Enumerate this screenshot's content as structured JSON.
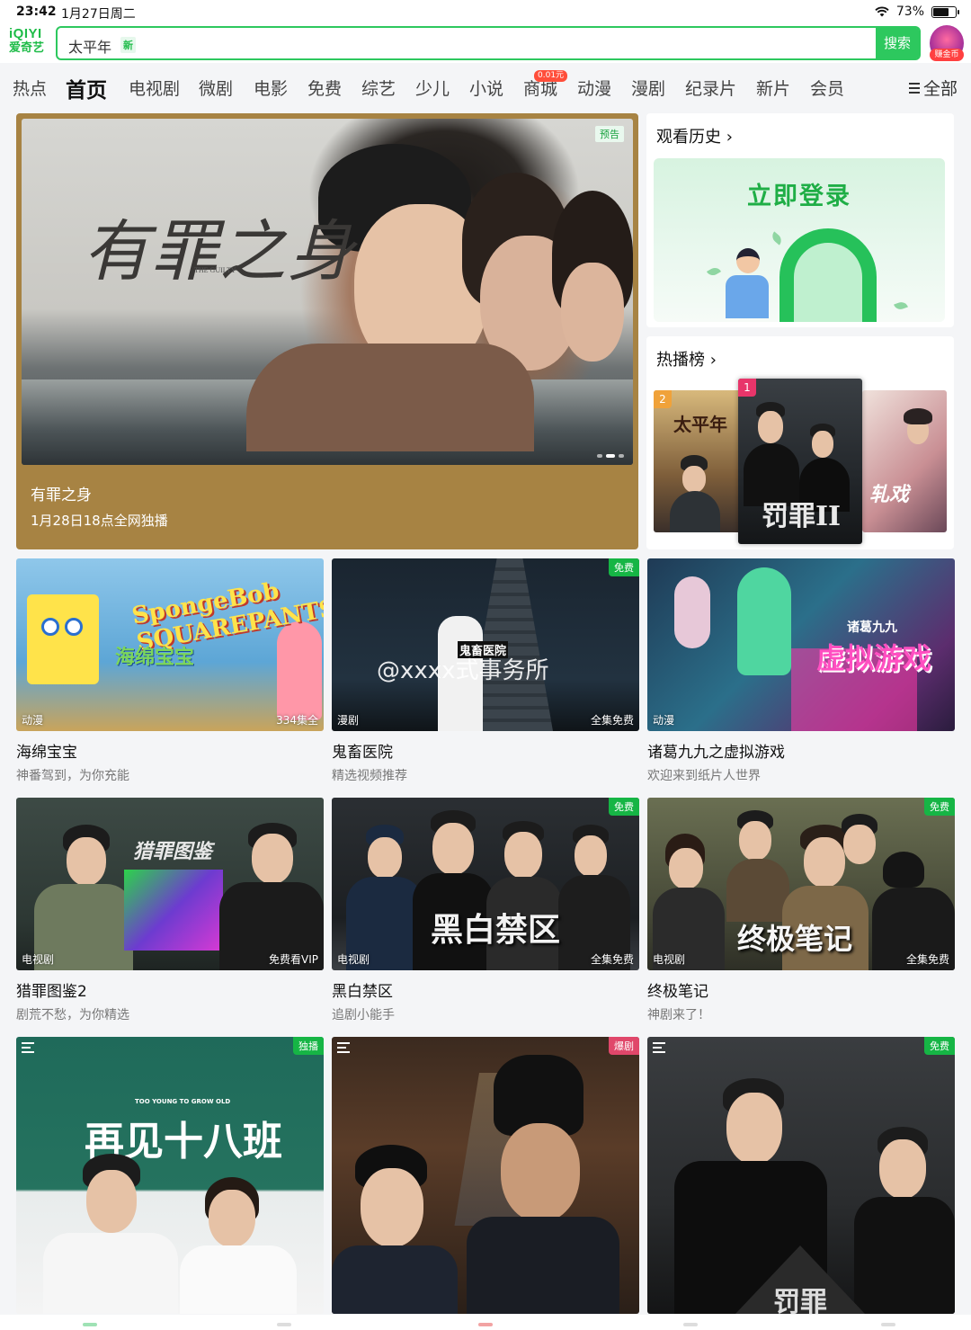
{
  "status": {
    "time": "23:42",
    "date": "1月27日周二",
    "battery": "73%",
    "battery_level": 0.73
  },
  "header": {
    "logo_en": "iQIYI",
    "logo_cn": "爱奇艺",
    "search_query": "太平年",
    "search_new_tag": "新",
    "search_button": "搜索",
    "coin_label": "赚金币"
  },
  "nav": {
    "items": [
      "热点",
      "首页",
      "电视剧",
      "微剧",
      "电影",
      "免费",
      "综艺",
      "少儿",
      "小说",
      "商城",
      "动漫",
      "漫剧",
      "纪录片",
      "新片",
      "会员"
    ],
    "active": "首页",
    "mall_badge": "0.01元",
    "all_label": "全部"
  },
  "hero": {
    "calligraphy": "有罪之身",
    "calligraphy_en": "THE GUILTY",
    "tag": "预告",
    "title": "有罪之身",
    "subtitle": "1月28日18点全网独播",
    "accent": "#a78343"
  },
  "history": {
    "title": "观看历史 ›",
    "login_text": "立即登录"
  },
  "hot": {
    "title": "热播榜 ›",
    "posters": [
      {
        "rank": "2",
        "text": "太平年",
        "rank_color": "#f0a23a"
      },
      {
        "rank": "1",
        "text": "罚罪II",
        "rank_color": "#e8356a"
      },
      {
        "rank": "",
        "text": "轧戏",
        "rank_color": ""
      }
    ]
  },
  "cards": [
    {
      "title": "海绵宝宝",
      "subtitle": "神番驾到，为你充能",
      "category": "动漫",
      "extra": "334集全",
      "tag": "",
      "poster_text": "SpongeBob SQUAREPANTS",
      "poster_cn": "海绵宝宝"
    },
    {
      "title": "鬼畜医院",
      "subtitle": "精选视频推荐",
      "category": "漫剧",
      "extra": "全集免费",
      "tag": "免费",
      "poster_text": "鬼畜医院",
      "watermark": "@xxxx式事务所"
    },
    {
      "title": "诸葛九九之虚拟游戏",
      "subtitle": "欢迎来到纸片人世界",
      "category": "动漫",
      "extra": "",
      "tag": "",
      "poster_text": "虚拟游戏",
      "poster_small": "诸葛九九"
    },
    {
      "title": "猎罪图鉴2",
      "subtitle": "剧荒不愁，为你精选",
      "category": "电视剧",
      "extra": "免费看VIP",
      "tag": "",
      "poster_text": "猎罪图鉴"
    },
    {
      "title": "黑白禁区",
      "subtitle": "追剧小能手",
      "category": "电视剧",
      "extra": "全集免费",
      "tag": "免费",
      "poster_text": "黑白禁区"
    },
    {
      "title": "终极笔记",
      "subtitle": "神剧来了！",
      "category": "电视剧",
      "extra": "全集免费",
      "tag": "免费",
      "poster_text": "终极笔记"
    }
  ],
  "bottom_cards": [
    {
      "tag": "独播",
      "tag_style": "green",
      "poster_text": "再见十八班",
      "poster_en": "TOO YOUNG TO GROW OLD"
    },
    {
      "tag": "爆剧",
      "tag_style": "red",
      "poster_text": ""
    },
    {
      "tag": "免费",
      "tag_style": "green",
      "poster_text": "罚罪"
    }
  ],
  "colors": {
    "brand": "#2dc85e",
    "free_tag": "#16b545"
  }
}
